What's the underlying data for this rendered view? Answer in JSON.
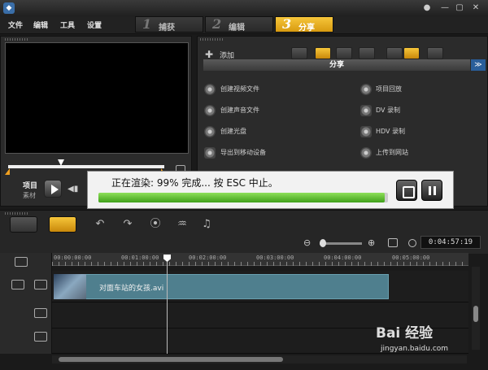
{
  "menu": {
    "items": [
      "文件",
      "编辑",
      "工具",
      "设置"
    ]
  },
  "steps": [
    {
      "num": "1",
      "label": "捕获",
      "active": false
    },
    {
      "num": "2",
      "label": "编辑",
      "active": false
    },
    {
      "num": "3",
      "label": "分享",
      "active": true
    }
  ],
  "preview": {
    "project_label": "项目",
    "clip_label": "素材"
  },
  "share": {
    "add_label": "添加",
    "header": "分享",
    "items_left": [
      "创建视频文件",
      "创建声音文件",
      "创建光盘",
      "导出到移动设备"
    ],
    "items_right": [
      "项目回放",
      "DV 录制",
      "HDV 录制",
      "上传到网站"
    ]
  },
  "render": {
    "message": "正在渲染: 99% 完成... 按 ESC 中止。",
    "progress": 0.99
  },
  "timeline": {
    "timecode": "0:04:57:19",
    "ruler_labels": [
      "00:00:00:00",
      "00:01:00:00",
      "00:02:00:00",
      "00:03:00:00",
      "00:04:00:00",
      "00:05:00:00"
    ],
    "clip_name": "对面车站的女孩.avi"
  },
  "watermark": {
    "logo": "Bai 经验",
    "url": "jingyan.baidu.com"
  },
  "colors": {
    "accent": "#f6c63a",
    "progress": "#5cc030",
    "clip": "#4f7f8e"
  }
}
